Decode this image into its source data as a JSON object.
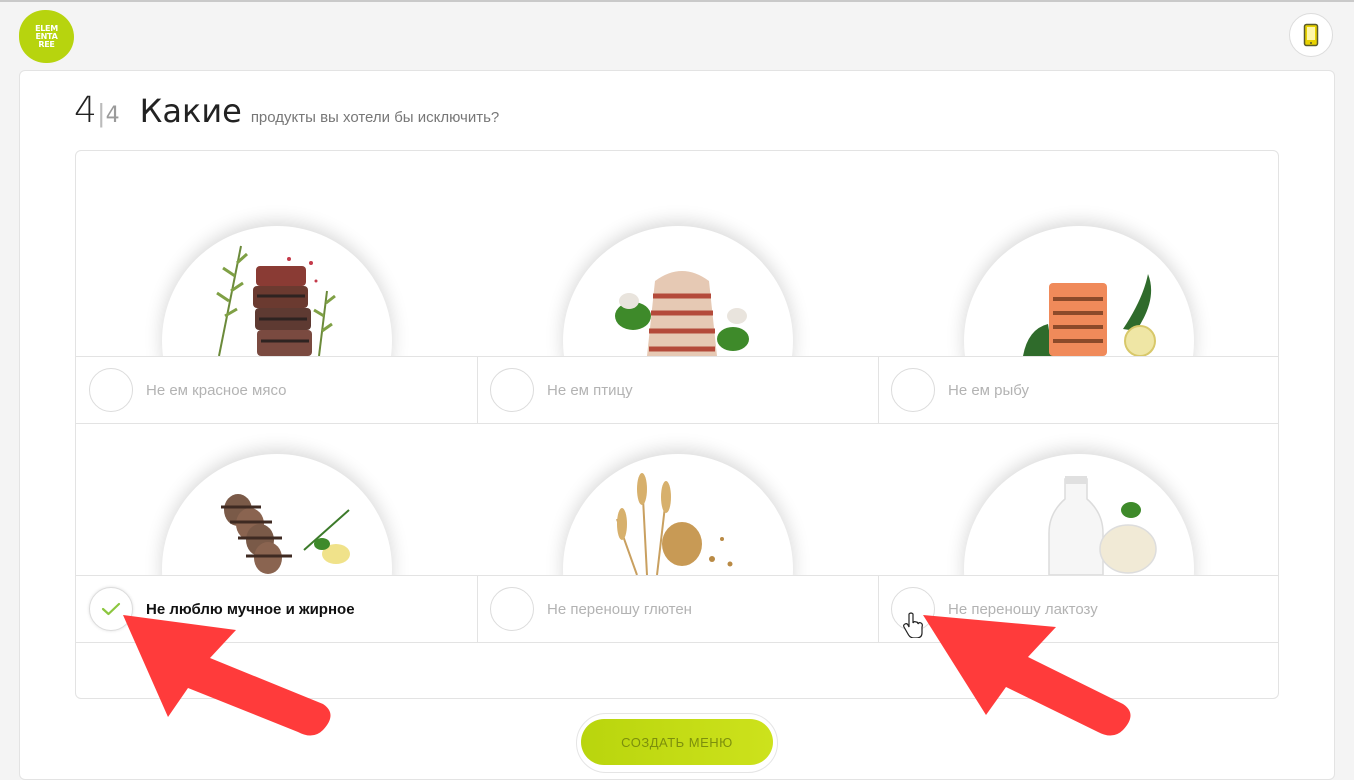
{
  "app": {
    "logo_lines": [
      "ELEM",
      "ENTA",
      "REE"
    ]
  },
  "question": {
    "step_current": "4",
    "step_separator": "|",
    "step_total": "4",
    "title_big": "Какие",
    "title_small": "продукты вы хотели бы исключить?"
  },
  "options": [
    {
      "label": "Не ем красное мясо",
      "checked": false,
      "image": "steak-plate"
    },
    {
      "label": "Не ем птицу",
      "checked": false,
      "image": "chicken-plate"
    },
    {
      "label": "Не ем рыбу",
      "checked": false,
      "image": "salmon-plate"
    },
    {
      "label": "Не люблю мучное и жирное",
      "checked": true,
      "image": "bread-plate"
    },
    {
      "label": "Не переношу глютен",
      "checked": false,
      "image": "wheat-plate"
    },
    {
      "label": "Не переношу лактозу",
      "checked": false,
      "image": "milk-plate"
    }
  ],
  "cta": {
    "label": "СОЗДАТЬ МЕНЮ"
  },
  "colors": {
    "accent": "#b9d50d",
    "check": "#8cc63f",
    "annotation_arrow": "#ff3b3b"
  }
}
